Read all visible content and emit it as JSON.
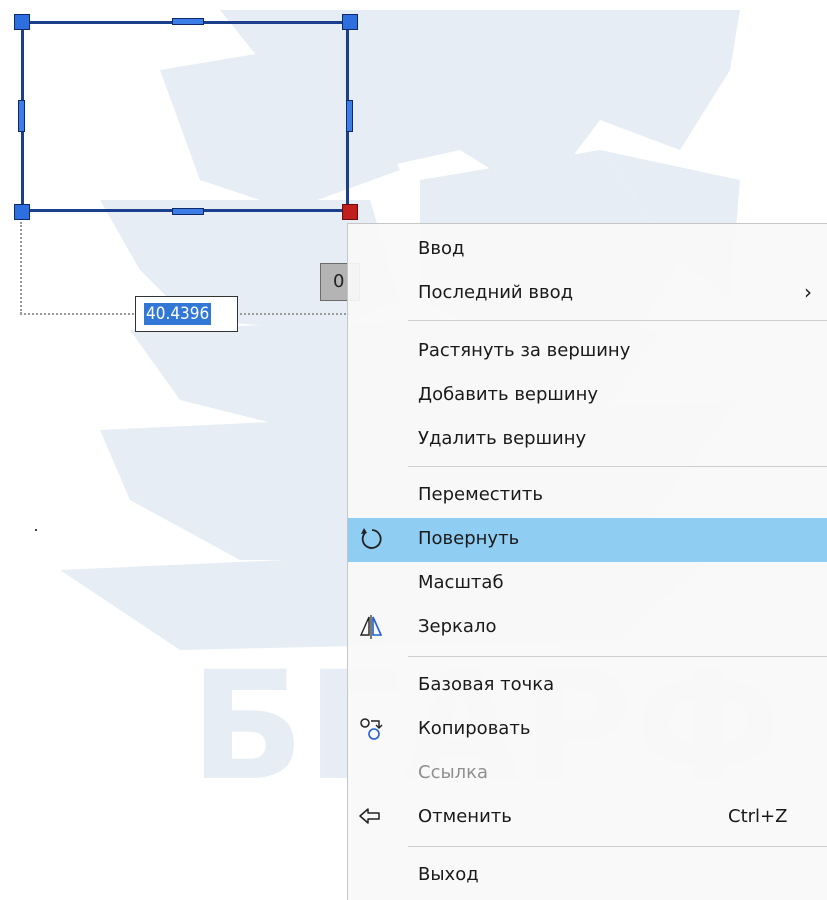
{
  "watermark": {
    "text": "БГАРФ",
    "logo_icon": "sailing-ship-icon",
    "color": "#e6edf4"
  },
  "drawing": {
    "selection_color": "#1b3f8a",
    "grip_color": "#2e6fe0",
    "hot_grip_color": "#c21e1e",
    "dimension_value": "40.4396",
    "angle_value": "0"
  },
  "context_menu": {
    "highlight_color": "#8fcdf3",
    "groups": [
      [
        {
          "label": "Ввод"
        },
        {
          "label": "Последний ввод",
          "submenu_arrow": "›"
        }
      ],
      [
        {
          "label": "Растянуть за вершину"
        },
        {
          "label": "Добавить вершину"
        },
        {
          "label": "Удалить вершину"
        }
      ],
      [
        {
          "label": "Переместить"
        },
        {
          "label": "Повернуть",
          "icon": "rotate-icon",
          "highlighted": true
        },
        {
          "label": "Масштаб"
        },
        {
          "label": "Зеркало",
          "icon": "mirror-icon"
        }
      ],
      [
        {
          "label": "Базовая точка"
        },
        {
          "label": "Копировать",
          "icon": "copy-icon"
        },
        {
          "label": "Ссылка",
          "disabled": true
        },
        {
          "label": "Отменить",
          "icon": "undo-icon",
          "shortcut": "Ctrl+Z"
        }
      ],
      [
        {
          "label": "Выход"
        }
      ]
    ]
  }
}
